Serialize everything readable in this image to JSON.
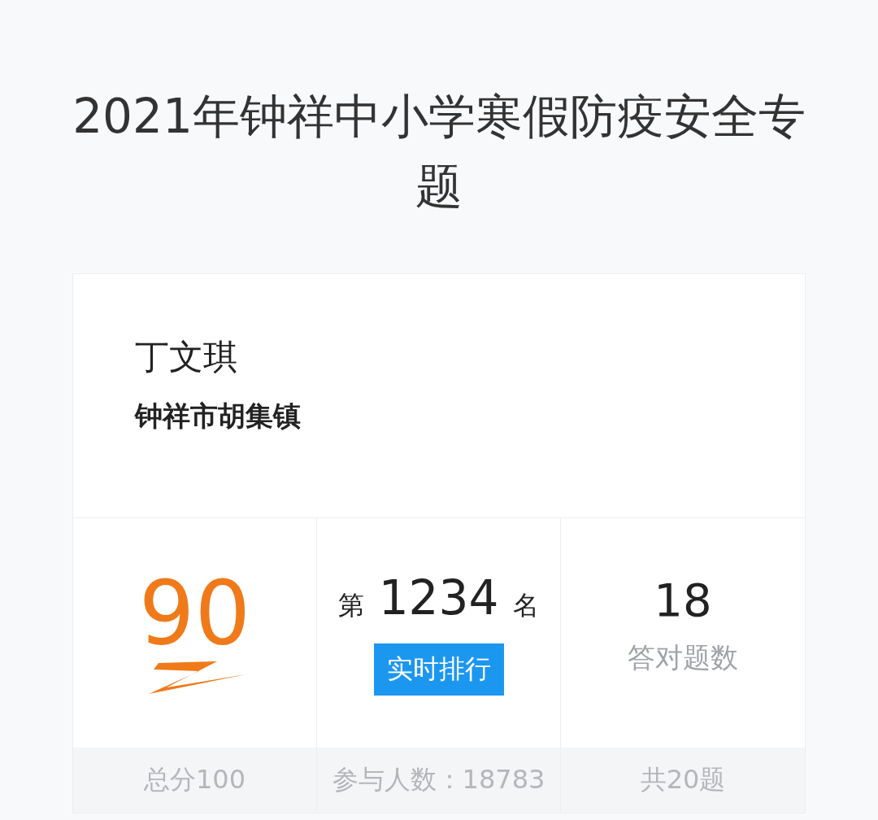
{
  "title": "2021年钟祥中小学寒假防疫安全专题",
  "profile": {
    "name": "丁文琪",
    "region": "钟祥市胡集镇"
  },
  "stats": [
    {
      "kind": "score",
      "value": "90",
      "footer": "总分100"
    },
    {
      "kind": "rank",
      "prefix": "第",
      "value": "1234",
      "suffix": "名",
      "button": "实时排行",
      "footer": "参与人数：18783"
    },
    {
      "kind": "count",
      "value": "18",
      "label": "答对题数",
      "footer": "共20题"
    }
  ]
}
